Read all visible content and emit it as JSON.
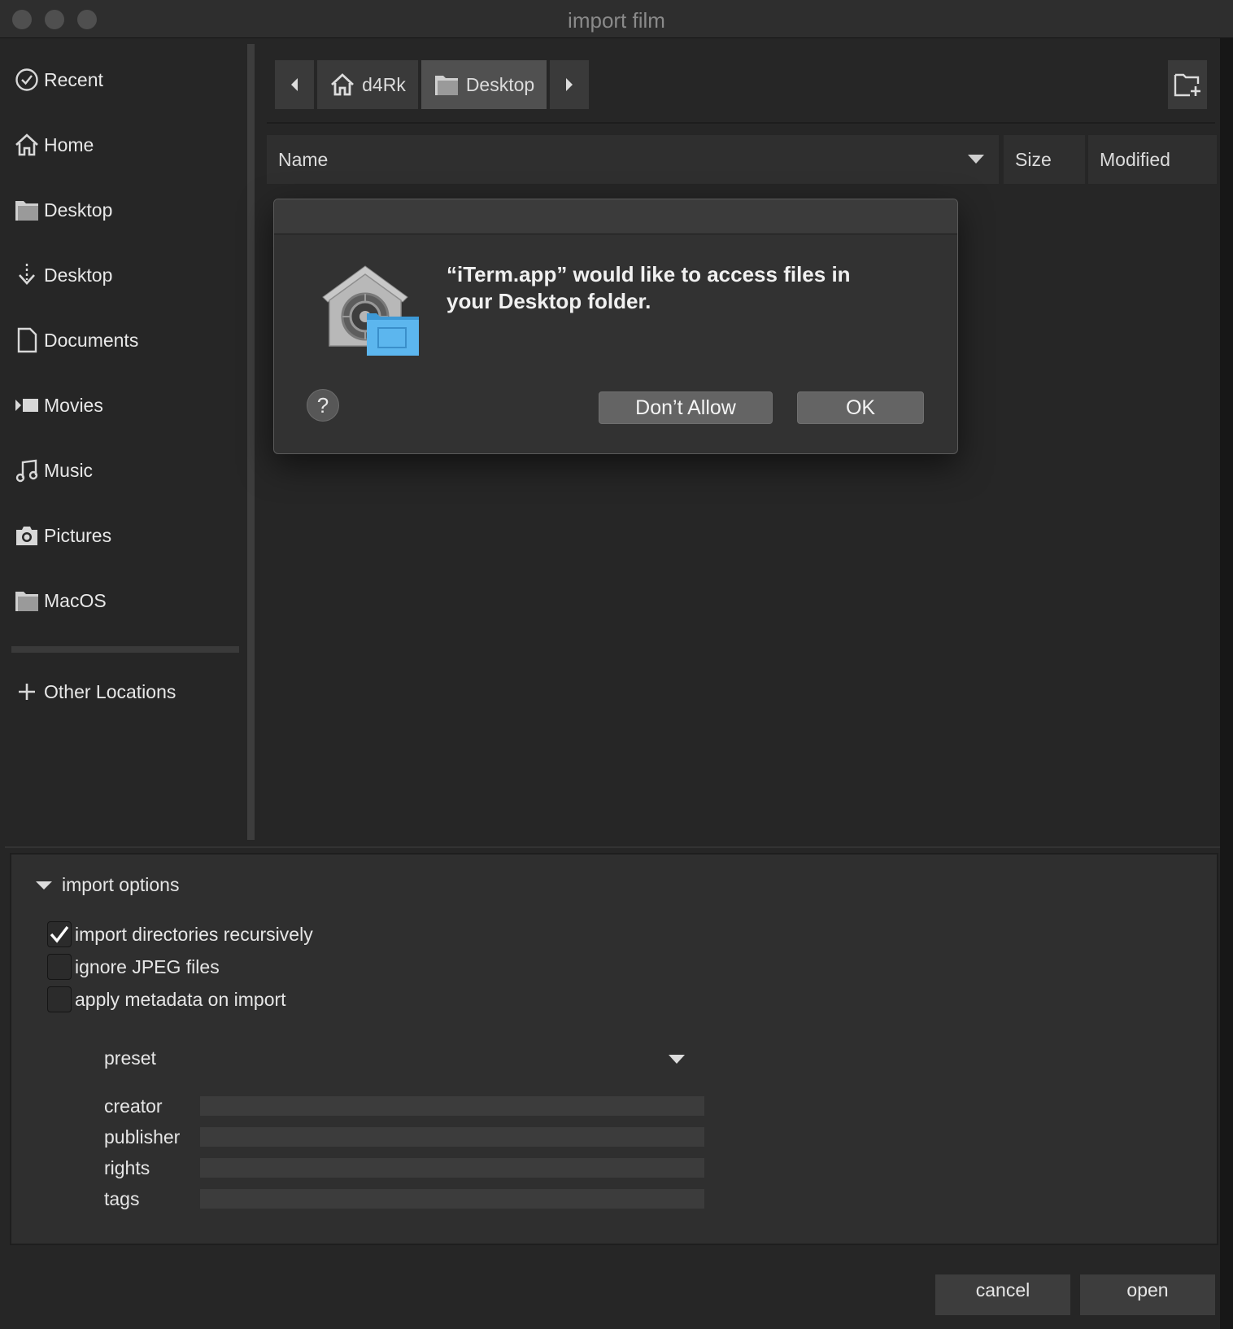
{
  "window": {
    "title": "import film"
  },
  "sidebar": {
    "items": [
      {
        "label": "Recent",
        "icon": "clock-icon"
      },
      {
        "label": "Home",
        "icon": "home-icon"
      },
      {
        "label": "Desktop",
        "icon": "folder-icon"
      },
      {
        "label": "Desktop",
        "icon": "download-icon"
      },
      {
        "label": "Documents",
        "icon": "document-icon"
      },
      {
        "label": "Movies",
        "icon": "movie-icon"
      },
      {
        "label": "Music",
        "icon": "music-icon"
      },
      {
        "label": "Pictures",
        "icon": "camera-icon"
      },
      {
        "label": "MacOS",
        "icon": "folder-icon"
      }
    ],
    "other_locations": "Other Locations"
  },
  "pathbar": {
    "home": "d4Rk",
    "current": "Desktop"
  },
  "columns": {
    "name": "Name",
    "size": "Size",
    "modified": "Modified"
  },
  "dialog": {
    "message": "“iTerm.app” would like to access files in your Desktop folder.",
    "help": "?",
    "dont_allow": "Don’t Allow",
    "ok": "OK"
  },
  "import_options": {
    "title": "import options",
    "options": [
      {
        "label": "import directories recursively",
        "checked": true
      },
      {
        "label": "ignore JPEG files",
        "checked": false
      },
      {
        "label": "apply metadata on import",
        "checked": false
      }
    ],
    "preset_label": "preset",
    "fields": [
      {
        "label": "creator",
        "value": ""
      },
      {
        "label": "publisher",
        "value": ""
      },
      {
        "label": "rights",
        "value": ""
      },
      {
        "label": "tags",
        "value": ""
      }
    ]
  },
  "buttons": {
    "cancel": "cancel",
    "open": "open"
  }
}
